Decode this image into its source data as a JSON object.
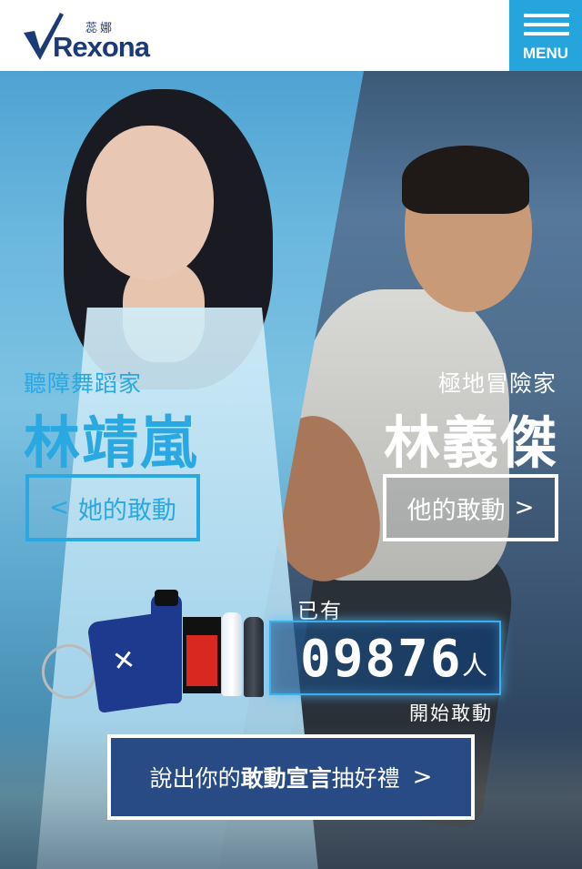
{
  "header": {
    "logo_cn": "蕊娜",
    "logo_en": "Rexona",
    "menu_label": "MENU"
  },
  "left_profile": {
    "subtitle": "聽障舞蹈家",
    "name": "林靖嵐",
    "button_label": "她的敢動",
    "chevron": "<"
  },
  "right_profile": {
    "subtitle": "極地冒險家",
    "name": "林義傑",
    "button_label": "他的敢動",
    "chevron": ">"
  },
  "counter": {
    "prefix": "已有",
    "value": "09876",
    "unit": "人",
    "cta": "開始敢動"
  },
  "cta": {
    "text_before": "說出你的",
    "text_bold": "敢動宣言",
    "text_after": "抽好禮",
    "chevron": ">"
  },
  "colors": {
    "brand_blue": "#1c3a78",
    "accent_cyan": "#29a8e2",
    "menu_bg": "#26a5dc",
    "cta_bg": "#284a85"
  }
}
